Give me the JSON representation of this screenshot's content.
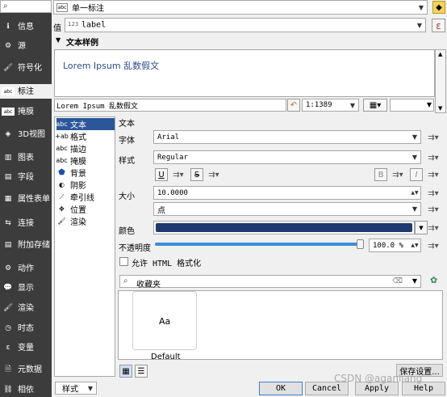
{
  "leftnav": {
    "items": [
      {
        "label": "信息",
        "icon": "info-icon"
      },
      {
        "label": "源",
        "icon": "source-icon"
      },
      {
        "label": "符号化",
        "icon": "symbology-icon"
      },
      {
        "label": "标注",
        "icon": "labels-icon"
      },
      {
        "label": "掩膜",
        "icon": "mask-icon"
      },
      {
        "label": "3D视图",
        "icon": "3d-view-icon"
      },
      {
        "label": "图表",
        "icon": "diagrams-icon"
      },
      {
        "label": "字段",
        "icon": "fields-icon"
      },
      {
        "label": "属性表单",
        "icon": "attributes-form-icon"
      },
      {
        "label": "连接",
        "icon": "joins-icon"
      },
      {
        "label": "附加存储",
        "icon": "auxiliary-storage-icon"
      },
      {
        "label": "动作",
        "icon": "actions-icon"
      },
      {
        "label": "显示",
        "icon": "display-icon"
      },
      {
        "label": "渲染",
        "icon": "rendering-icon"
      },
      {
        "label": "时态",
        "icon": "temporal-icon"
      },
      {
        "label": "变量",
        "icon": "variables-icon"
      },
      {
        "label": "元数据",
        "icon": "metadata-icon"
      },
      {
        "label": "相依",
        "icon": "dependencies-icon"
      }
    ]
  },
  "top": {
    "mode_value": "单一标注",
    "value_label": "值",
    "value_field": "label",
    "value_type_badge": "123",
    "expr_button": "ε"
  },
  "sample": {
    "header": "文本样例",
    "preview_text": "Lorem Ipsum 乱数假文",
    "input_text": "Lorem Ipsum 乱数假文",
    "scale": "1:1389"
  },
  "tree": {
    "items": [
      {
        "label": "文本",
        "icon": "text-icon"
      },
      {
        "label": "格式",
        "icon": "formatting-icon"
      },
      {
        "label": "描边",
        "icon": "buffer-icon"
      },
      {
        "label": "掩膜",
        "icon": "mask-icon"
      },
      {
        "label": "背景",
        "icon": "background-icon"
      },
      {
        "label": "阴影",
        "icon": "shadow-icon"
      },
      {
        "label": "牵引线",
        "icon": "callouts-icon"
      },
      {
        "label": "位置",
        "icon": "placement-icon"
      },
      {
        "label": "渲染",
        "icon": "rendering-icon"
      }
    ]
  },
  "text_panel": {
    "section_title": "文本",
    "font_label": "字体",
    "font_value": "Arial",
    "style_label": "样式",
    "style_value": "Regular",
    "size_label": "大小",
    "size_value": "10.0000",
    "unit_value": "点",
    "color_label": "颜色",
    "color_value": "#1f3a6e",
    "opacity_label": "不透明度",
    "opacity_value": "100.0 %",
    "opacity_fraction": 1.0,
    "html_label": "允许 HTML 格式化",
    "underline": "U",
    "strike": "S",
    "bold": "B",
    "italic": "I"
  },
  "favorites": {
    "search_placeholder": "收藏夹",
    "card_preview": "Aa",
    "card_name": "Default",
    "save_button": "保存设置..."
  },
  "footer": {
    "style_button": "样式",
    "ok": "OK",
    "cancel": "Cancel",
    "apply": "Apply",
    "help": "Help",
    "watermark": "CSDN @aganliang"
  }
}
